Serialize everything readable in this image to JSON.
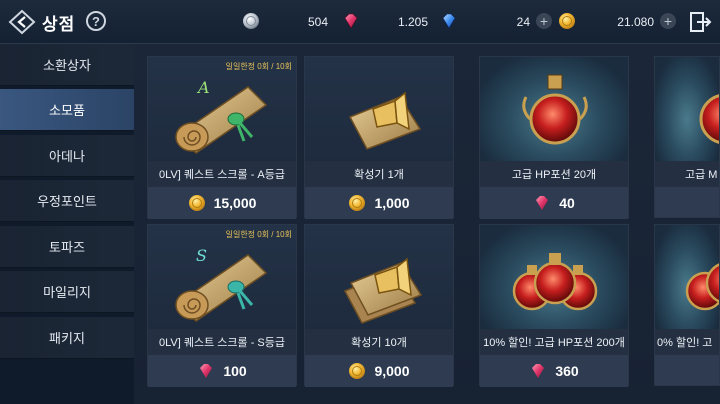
{
  "header": {
    "title": "상점",
    "help_icon": "?",
    "currencies": [
      {
        "icon": "silver-coin-icon",
        "value": "504"
      },
      {
        "icon": "red-gem-icon",
        "value": "1.205"
      },
      {
        "icon": "blue-gem-icon",
        "value": "24"
      },
      {
        "icon": "gold-coin-icon",
        "value": "21.080"
      }
    ]
  },
  "sidebar": {
    "items": [
      {
        "label": "소환상자"
      },
      {
        "label": "소모품",
        "active": true
      },
      {
        "label": "아데나"
      },
      {
        "label": "우정포인트"
      },
      {
        "label": "토파즈"
      },
      {
        "label": "마일리지"
      },
      {
        "label": "패키지"
      }
    ]
  },
  "cards": [
    {
      "name": "0LV] 퀘스트 스크롤 - A등급",
      "price": "15,000",
      "currency": "gold-coin-icon",
      "limit": "일일한정 0회 / 10회",
      "art": "scroll-a-icon"
    },
    {
      "name": "확성기 1개",
      "price": "1,000",
      "currency": "gold-coin-icon",
      "art": "megaphone-icon"
    },
    {
      "name": "고급 HP포션 20개",
      "price": "40",
      "currency": "red-gem-icon",
      "art": "hp-potion-icon"
    },
    {
      "name": "고급 M",
      "price": "",
      "currency": "red-gem-icon",
      "art": "mp-potion-icon"
    },
    {
      "name": "0LV] 퀘스트 스크롤 - S등급",
      "price": "100",
      "currency": "red-gem-icon",
      "limit": "일일한정 0회 / 10회",
      "art": "scroll-s-icon"
    },
    {
      "name": "확성기 10개",
      "price": "9,000",
      "currency": "gold-coin-icon",
      "art": "megaphones-icon"
    },
    {
      "name": "10% 할인! 고급 HP포션 200개",
      "price": "360",
      "currency": "red-gem-icon",
      "art": "hp-potions-icon"
    },
    {
      "name": "0% 할인! 고",
      "price": "",
      "currency": "red-gem-icon",
      "art": "mp-potions-icon"
    }
  ],
  "colors": {
    "active_tab": "#3a5780",
    "gold": "#f2b833",
    "red_gem": "#e0356a",
    "blue_gem": "#3d8df0",
    "limit_text": "#e8c45a"
  }
}
